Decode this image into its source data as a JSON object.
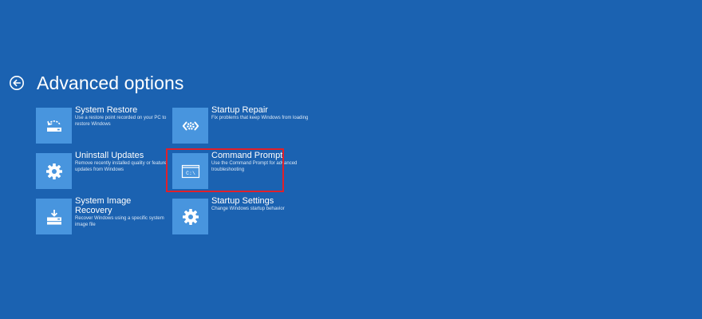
{
  "page": {
    "title": "Advanced options",
    "back_icon": "back-arrow-circle-icon"
  },
  "colors": {
    "background": "#1b62b1",
    "tile": "#4895de",
    "highlight": "#e0202b"
  },
  "options": [
    {
      "title": "System Restore",
      "description": "Use a restore point recorded on your PC to restore Windows",
      "icon": "system-restore-icon"
    },
    {
      "title": "Startup Repair",
      "description": "Fix problems that keep Windows from loading",
      "icon": "startup-repair-icon"
    },
    {
      "title": "Uninstall Updates",
      "description": "Remove recently installed quality or feature updates from Windows",
      "icon": "gear-icon"
    },
    {
      "title": "Command Prompt",
      "description": "Use the Command Prompt for advanced troubleshooting",
      "icon": "command-prompt-icon",
      "icon_text": "C:\\"
    },
    {
      "title": "System Image Recovery",
      "description": "Recover Windows using a specific system image file",
      "icon": "system-image-recovery-icon"
    },
    {
      "title": "Startup Settings",
      "description": "Change Windows startup behavior",
      "icon": "gear-icon"
    }
  ]
}
